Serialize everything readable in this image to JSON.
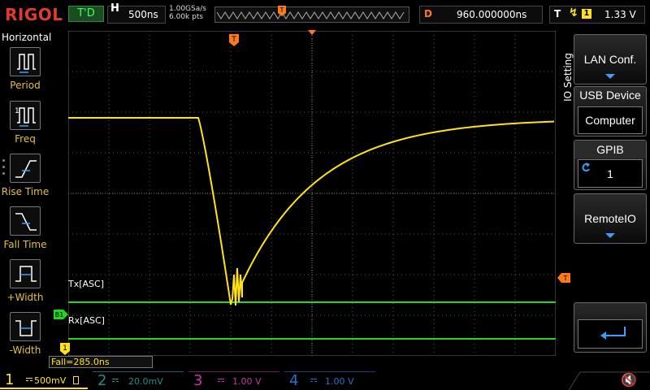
{
  "brand": "RIGOL",
  "run_status": "T'D",
  "horizontal": {
    "key": "H",
    "timebase": "500ns",
    "sample_rate": "1.00GSa/s",
    "memory_depth": "6.00k pts"
  },
  "delay": {
    "key": "D",
    "value": "960.000000ns"
  },
  "trigger": {
    "key": "T",
    "source": "1",
    "level": "1.33 V"
  },
  "left_menu": {
    "title": "Horizontal",
    "items": [
      {
        "label": "Period",
        "icon": "period-icon"
      },
      {
        "label": "Freq",
        "icon": "frequency-icon"
      },
      {
        "label": "Rise Time",
        "icon": "rise-time-icon"
      },
      {
        "label": "Fall Time",
        "icon": "fall-time-icon"
      },
      {
        "label": "+Width",
        "icon": "positive-width-icon"
      },
      {
        "label": "-Width",
        "icon": "negative-width-icon"
      }
    ]
  },
  "right_menu": {
    "title": "IO Setting",
    "lan": {
      "label": "LAN Conf."
    },
    "usb": {
      "label": "USB Device",
      "value": "Computer"
    },
    "gpib": {
      "label": "GPIB",
      "value": "1"
    },
    "remote": {
      "label": "RemoteIO"
    },
    "back_icon": "return-icon"
  },
  "channel_labels": {
    "tx": "Tx[ASC]",
    "rx": "Rx[ASC]"
  },
  "markers": {
    "trigger_pos": "T",
    "bus_marker": "B1",
    "ch1_marker": "1"
  },
  "measurement": "Fall=285.0ns",
  "channels": [
    {
      "num": "1",
      "scale": "500mV",
      "color": "#ffe21a",
      "active": true
    },
    {
      "num": "2",
      "scale": "20.0mV",
      "color": "#1f8f8f",
      "active": false
    },
    {
      "num": "3",
      "scale": "1.00 V",
      "color": "#c43aa0",
      "active": false
    },
    {
      "num": "4",
      "scale": "1.00 V",
      "color": "#2b6fd6",
      "active": false
    }
  ],
  "colors": {
    "ch1": "#ffe21a",
    "bus": "#22d622",
    "trigger": "#ff7a1c",
    "grid": "#555555",
    "accent_blue": "#3b9dff"
  }
}
